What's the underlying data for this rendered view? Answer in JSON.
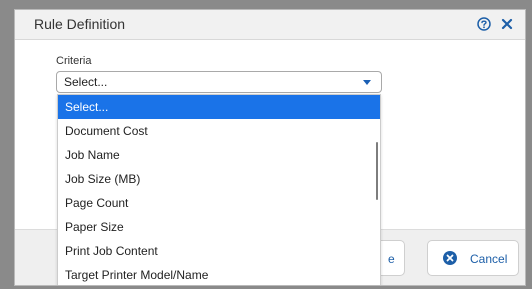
{
  "dialog": {
    "title": "Rule Definition"
  },
  "form": {
    "criteria_label": "Criteria",
    "criteria_value": "Select..."
  },
  "dropdown": {
    "options": [
      "Select...",
      "Document Cost",
      "Job Name",
      "Job Size (MB)",
      "Page Count",
      "Paper Size",
      "Print Job Content",
      "Target Printer Model/Name"
    ],
    "selected_index": 0
  },
  "footer": {
    "save_label_partial": "e",
    "cancel_label": "Cancel"
  },
  "colors": {
    "accent": "#1a73e8",
    "link": "#1d5fa8"
  },
  "icons": {
    "help": "help-circle-icon",
    "close": "close-icon",
    "cancel": "cancel-circle-icon",
    "dropdown_arrow": "caret-down-icon"
  }
}
